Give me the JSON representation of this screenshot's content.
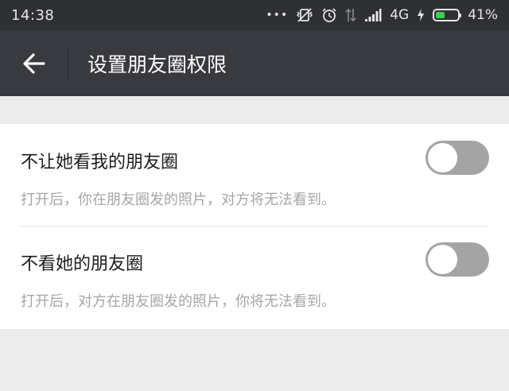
{
  "status_bar": {
    "time": "14:38",
    "dots": "•••",
    "network": "4G",
    "battery_percent": "41%",
    "battery_level": 0.41,
    "icons": [
      "more-dots-icon",
      "vibrate-off-icon",
      "alarm-icon",
      "data-arrows-icon",
      "signal-icon",
      "charging-bolt-icon",
      "battery-icon"
    ]
  },
  "header": {
    "title": "设置朋友圈权限",
    "back_icon": "arrow-left-icon"
  },
  "settings": [
    {
      "label": "不让她看我的朋友圈",
      "description": "打开后，你在朋友圈发的照片，对方将无法看到。",
      "enabled": false
    },
    {
      "label": "不看她的朋友圈",
      "description": "打开后，对方在朋友圈发的照片，你将无法看到。",
      "enabled": false
    }
  ],
  "colors": {
    "status_bar_bg": "#2f3034",
    "app_bar_bg": "#393a3f",
    "page_bg": "#ececec",
    "toggle_off": "#a4a4a4",
    "toggle_on": "#1aad19",
    "battery_fill": "#3fcf4f"
  }
}
